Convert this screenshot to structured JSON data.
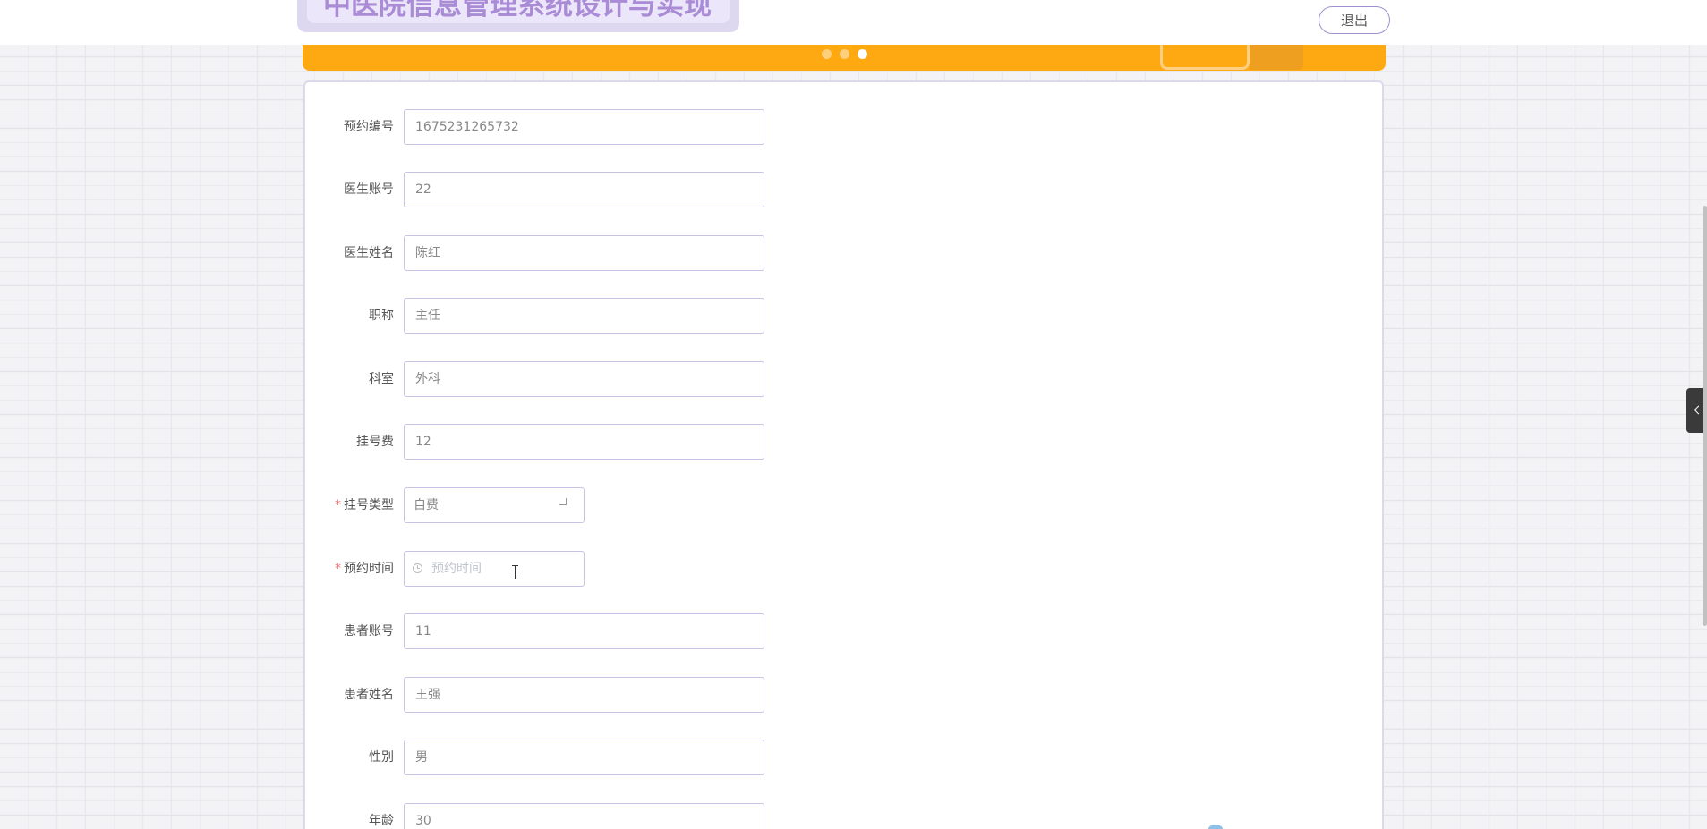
{
  "header": {
    "site_title": "中医院信息管理系统设计与实现",
    "logout_label": "退出"
  },
  "carousel": {
    "dot_count": 3,
    "active_index": 2
  },
  "form": {
    "fields": {
      "appointment_no": {
        "label": "预约编号",
        "value": "1675231265732"
      },
      "doctor_account": {
        "label": "医生账号",
        "value": "22"
      },
      "doctor_name": {
        "label": "医生姓名",
        "value": "陈红"
      },
      "title": {
        "label": "职称",
        "value": "主任"
      },
      "department": {
        "label": "科室",
        "value": "外科"
      },
      "registration_fee": {
        "label": "挂号费",
        "value": "12"
      },
      "registration_type": {
        "label": "挂号类型",
        "value": "自费",
        "required": "*"
      },
      "appointment_time": {
        "label": "预约时间",
        "placeholder": "预约时间",
        "required": "*"
      },
      "patient_account": {
        "label": "患者账号",
        "value": "11"
      },
      "patient_name": {
        "label": "患者姓名",
        "value": "王强"
      },
      "gender": {
        "label": "性别",
        "value": "男"
      },
      "age": {
        "label": "年龄",
        "value": "30"
      }
    }
  },
  "colors": {
    "accent": "#ffa912",
    "title_text": "#a98bd6",
    "border": "#c7c4e6",
    "required": "#f56c6c"
  },
  "icons": {
    "time_field": "clock-icon",
    "side_toggle": "chevron-left-icon",
    "select_caret": "chevron-down-icon"
  }
}
